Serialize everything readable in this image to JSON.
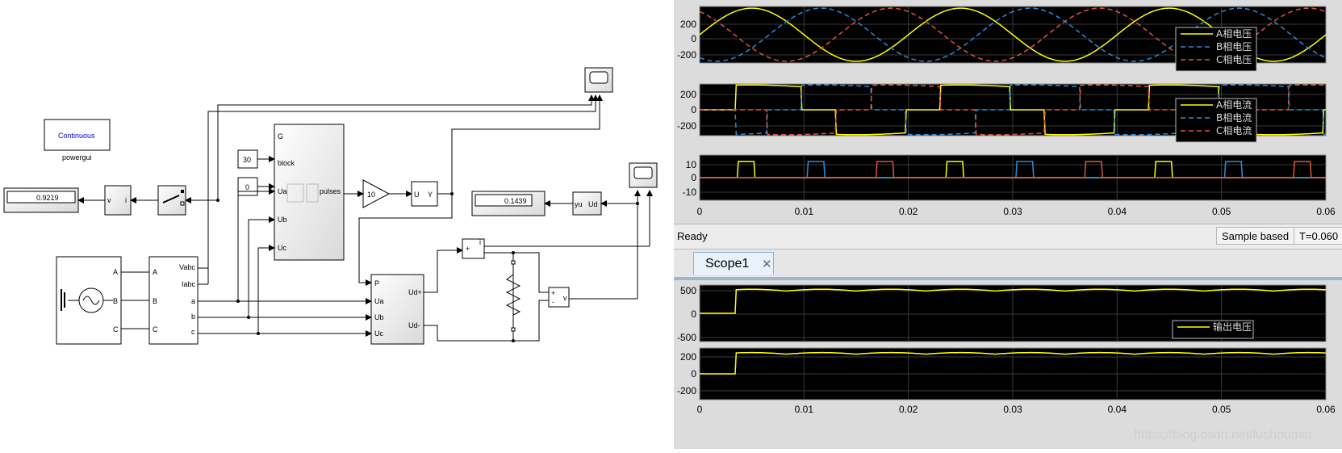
{
  "simulink": {
    "powergui": {
      "name": "powergui",
      "mode": "Continuous"
    },
    "display_left_value": "0.9219",
    "display_right_value": "0.1439",
    "const_g": "30",
    "const_block": "0",
    "gain_value": "10",
    "source_ports": [
      "A",
      "B",
      "C"
    ],
    "meas_ports_in": [
      "A",
      "B",
      "C"
    ],
    "meas_ports_out": [
      "Vabc",
      "Iabc",
      "a",
      "b",
      "c"
    ],
    "pulse_gen_ports_in": [
      "G",
      "block",
      "Ua",
      "Ub",
      "Uc"
    ],
    "pulse_gen_port_out": "pulses",
    "bridge_ports_in": [
      "P",
      "Ua",
      "Ub",
      "Uc"
    ],
    "bridge_ports_out": [
      "Ud+",
      "Ud-"
    ],
    "uy_block": {
      "in": "U",
      "out": "Y"
    },
    "yu_block": {
      "in": "yu",
      "out": "Ud"
    },
    "sum_block": {
      "plus": "+",
      "minus": "-",
      "out": "i"
    },
    "vmeas_block": {
      "plus": "+",
      "minus": "-",
      "out": "v"
    },
    "meter_block": {
      "in": "v",
      "out": "i"
    }
  },
  "scope_top": {
    "status": "Ready",
    "sample_mode": "Sample based",
    "time": "T=0.060",
    "x_ticks": [
      "0",
      "0.01",
      "0.02",
      "0.03",
      "0.04",
      "0.05",
      "0.06"
    ],
    "axes": [
      {
        "yticks": [
          "200",
          "0",
          "-200"
        ],
        "legend": [
          "A相电压",
          "B相电压",
          "C相电压"
        ]
      },
      {
        "yticks": [
          "200",
          "0",
          "-200"
        ],
        "legend": [
          "A相电流",
          "B相电流",
          "C相电流"
        ]
      },
      {
        "yticks": [
          "10",
          "0",
          "-10"
        ],
        "legend": []
      }
    ]
  },
  "scope_bottom": {
    "tab_label": "Scope1",
    "x_ticks": [
      "0",
      "0.01",
      "0.02",
      "0.03",
      "0.04",
      "0.05",
      "0.06"
    ],
    "axes": [
      {
        "yticks": [
          "500",
          "0",
          "-500"
        ],
        "legend": [
          "输出电压"
        ]
      },
      {
        "yticks": [
          "200",
          "0",
          "-200"
        ],
        "legend": []
      }
    ]
  },
  "watermark": "https://blog.csdn.net/lushoumin",
  "colors": {
    "yellow": "#ffff00",
    "blue": "#2c8cd8",
    "red": "#e0553b",
    "plot_bg": "#000000",
    "grid": "#3a3a3a"
  }
}
